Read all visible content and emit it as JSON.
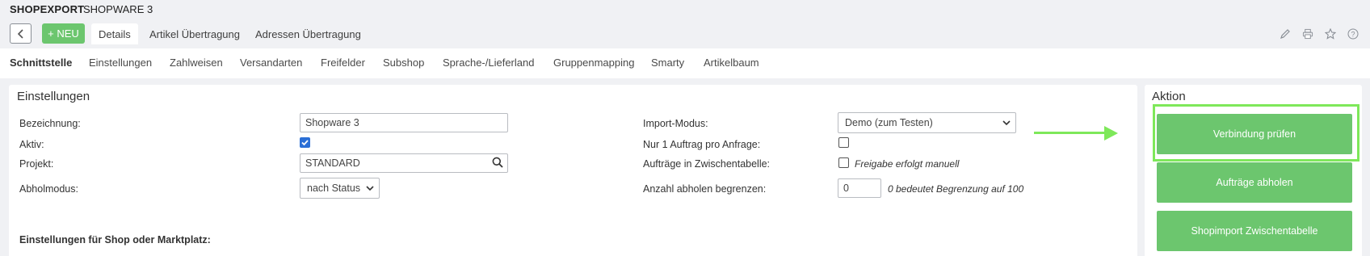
{
  "header": {
    "brand": "SHOPEXPORT",
    "subtitle": "SHOPWARE 3"
  },
  "toolbar": {
    "new_label": "+ NEU",
    "tabs": [
      "Details",
      "Artikel Übertragung",
      "Adressen Übertragung"
    ],
    "icons": [
      "pencil-icon",
      "print-icon",
      "star-icon",
      "help-icon"
    ]
  },
  "subnav": {
    "items": [
      "Schnittstelle",
      "Einstellungen",
      "Zahlweisen",
      "Versandarten",
      "Freifelder",
      "Subshop",
      "Sprache-/Lieferland",
      "Gruppenmapping",
      "Smarty",
      "Artikelbaum"
    ]
  },
  "settings": {
    "title": "Einstellungen",
    "bezeichnung_label": "Bezeichnung:",
    "bezeichnung_value": "Shopware 3",
    "aktiv_label": "Aktiv:",
    "aktiv_checked": true,
    "projekt_label": "Projekt:",
    "projekt_value": "STANDARD",
    "abholmodus_label": "Abholmodus:",
    "abholmodus_value": "nach Status",
    "import_modus_label": "Import-Modus:",
    "import_modus_value": "Demo (zum Testen)",
    "nur1_label": "Nur 1 Auftrag pro Anfrage:",
    "nur1_checked": false,
    "zwischentabelle_label": "Aufträge in Zwischentabelle:",
    "zwischentabelle_checked": false,
    "zwischentabelle_hint": "Freigabe erfolgt manuell",
    "anzahl_label": "Anzahl abholen begrenzen:",
    "anzahl_value": "0",
    "anzahl_hint": "0 bedeutet Begrenzung auf 100",
    "shop_section_title": "Einstellungen für Shop oder Marktplatz:"
  },
  "aktion": {
    "title": "Aktion",
    "buttons": [
      "Verbindung prüfen",
      "Aufträge abholen",
      "Shopimport Zwischentabelle"
    ]
  },
  "colors": {
    "accent": "#6cc66e",
    "highlight": "#7ee85a",
    "checkbox": "#2b6fd6"
  }
}
